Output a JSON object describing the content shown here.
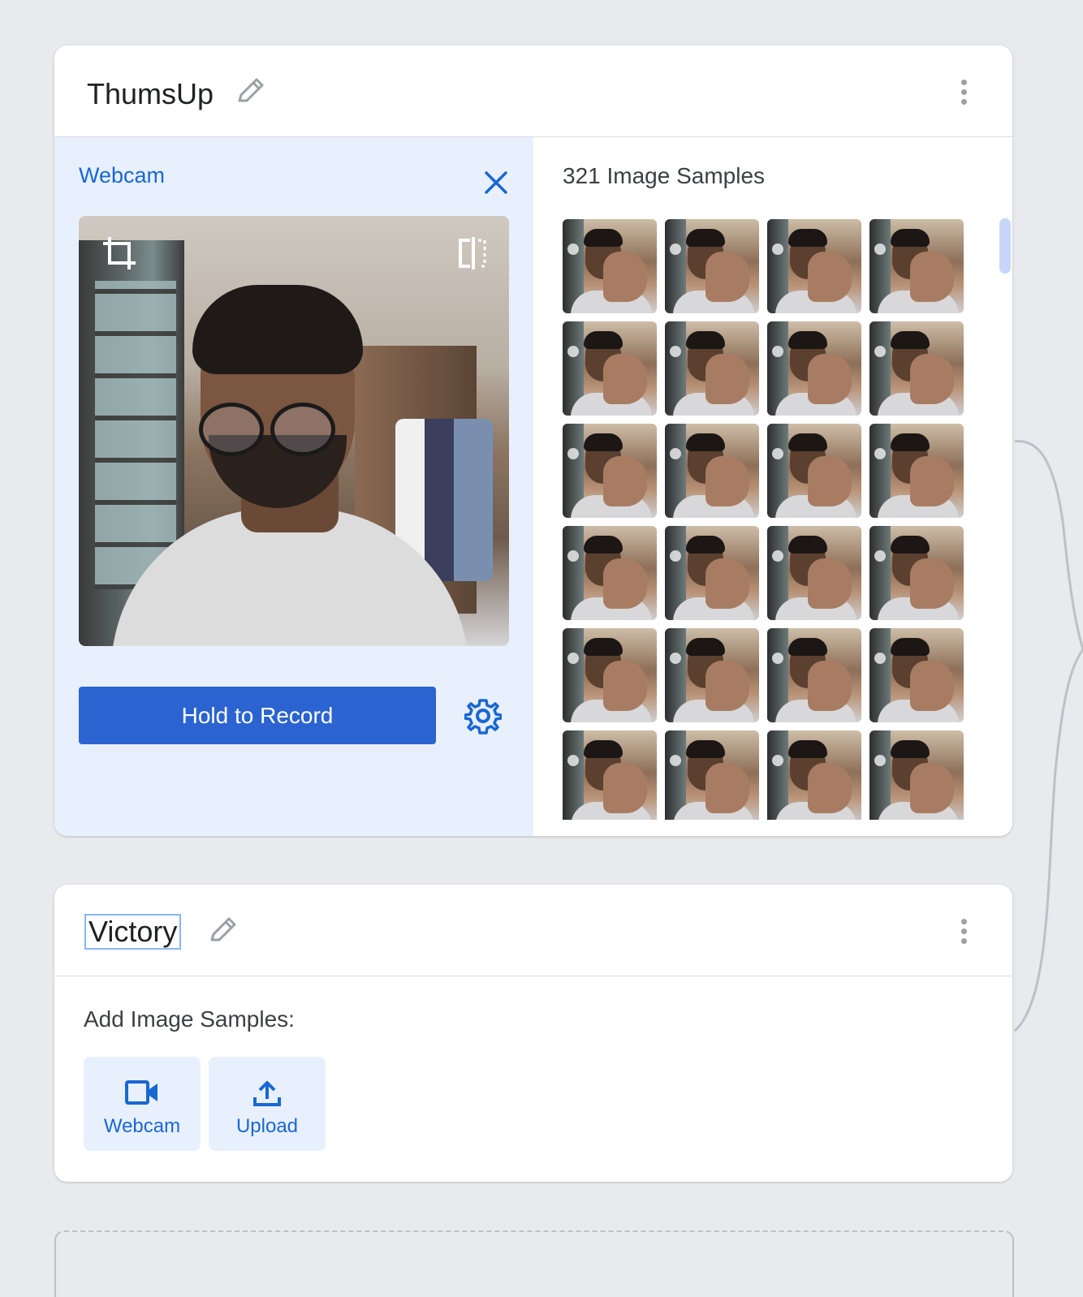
{
  "classes": [
    {
      "name": "ThumsUp",
      "webcam_panel": {
        "title": "Webcam",
        "record_label": "Hold to Record"
      },
      "samples": {
        "count_label": "321 Image Samples"
      }
    },
    {
      "name": "Victory",
      "add_samples": {
        "label": "Add Image Samples:",
        "webcam_label": "Webcam",
        "upload_label": "Upload"
      }
    }
  ],
  "colors": {
    "accent": "#1967d2",
    "primary_button": "#2b63d1",
    "panel_bg": "#e8f0fe",
    "page_bg": "#e8eaed"
  },
  "icons": [
    "edit-icon",
    "more-vert-icon",
    "close-icon",
    "crop-icon",
    "flip-icon",
    "settings-icon",
    "videocam-icon",
    "upload-icon"
  ]
}
